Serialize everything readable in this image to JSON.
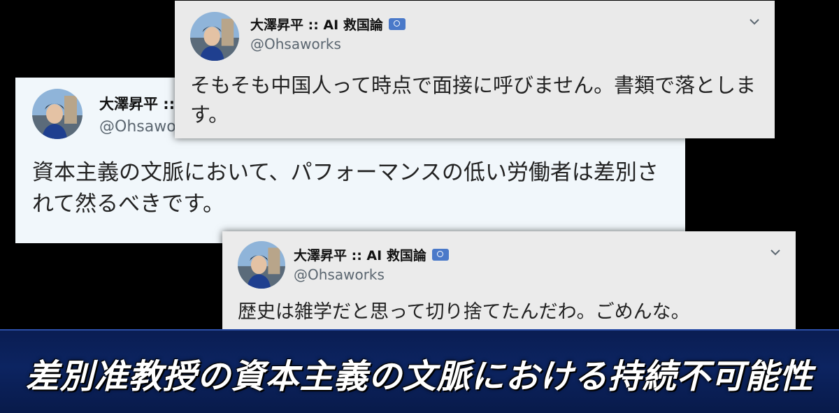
{
  "tweets": [
    {
      "display_name": "大澤昇平 :: AI 救国論",
      "handle": "@Ohsaworks",
      "text": "資本主義の文脈において、パフォーマンスの低い労働者は差別されて然るべきです。",
      "background": "#f1f7fb"
    },
    {
      "display_name": "大澤昇平 :: AI 救国論",
      "handle": "@Ohsaworks",
      "text": "そもそも中国人って時点で面接に呼びません。書類で落とします。",
      "background": "#eaeaea"
    },
    {
      "display_name": "大澤昇平 :: AI 救国論",
      "handle": "@Ohsaworks",
      "text": "歴史は雑学だと思って切り捨てたんだわ。ごめんな。",
      "background": "#ebebeb"
    }
  ],
  "icons": {
    "verified": "un-emblem-icon",
    "menu": "chevron-down-icon",
    "avatar": "avatar"
  },
  "banner": {
    "headline": "差別准教授の資本主義の文脈における持続不可能性",
    "background": "#0c2461",
    "text_color": "#ffffff"
  }
}
